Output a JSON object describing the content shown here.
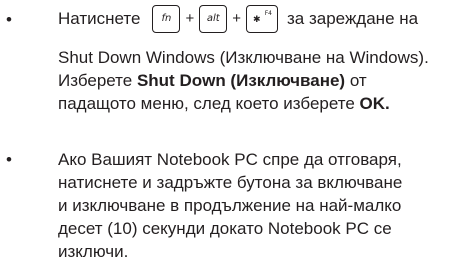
{
  "bullets": {
    "symbol": "•"
  },
  "item1": {
    "intro": "Натиснете",
    "keys": {
      "fn": "fn",
      "alt": "alt",
      "f4_label": "F4",
      "plus": "+"
    },
    "after_keys": "за зареждане на",
    "line2": "Shut Down Windows (Изключване на Windows).",
    "line3_pre": "Изберете ",
    "line3_bold": "Shut Down (Изключване)",
    "line3_post": " от",
    "line4_pre": "падащото меню, след което изберете ",
    "line4_bold": "OK."
  },
  "item2": {
    "lines": [
      "Ако Вашият Notebook PC спре да отговаря,",
      "натиснете и задръжте бутона за включване",
      "и изключване в продължение на най-малко",
      "десет (10) секунди докато Notebook PC се",
      "изключи."
    ]
  }
}
